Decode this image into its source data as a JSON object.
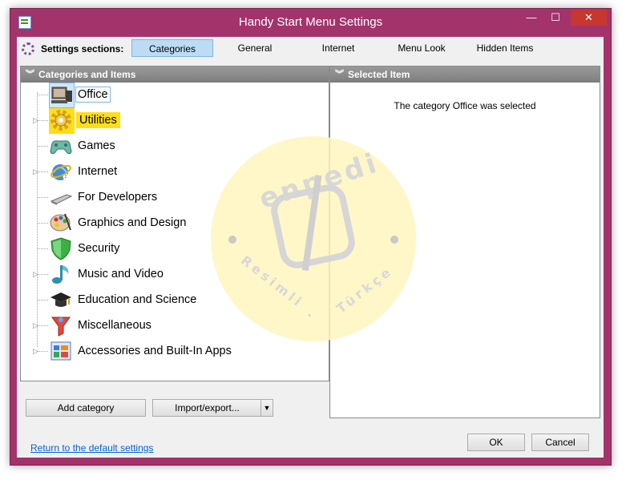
{
  "window": {
    "title": "Handy Start Menu Settings",
    "minimize_glyph": "—",
    "maximize_glyph": "☐",
    "close_glyph": "✕"
  },
  "toolbar": {
    "label": "Settings sections:",
    "tabs": [
      "Categories",
      "General",
      "Internet",
      "Menu Look",
      "Hidden Items"
    ],
    "active_tab": "Categories"
  },
  "left_panel": {
    "header": "Categories and Items",
    "categories": [
      {
        "label": "Office",
        "icon": "office-icon",
        "expandable": false,
        "state": "selected"
      },
      {
        "label": "Utilities",
        "icon": "utilities-gear-icon",
        "expandable": true,
        "state": "highlighted"
      },
      {
        "label": "Games",
        "icon": "gamepad-icon",
        "expandable": false,
        "state": "normal"
      },
      {
        "label": "Internet",
        "icon": "internet-explorer-icon",
        "expandable": true,
        "state": "normal"
      },
      {
        "label": "For Developers",
        "icon": "developer-tools-icon",
        "expandable": false,
        "state": "normal"
      },
      {
        "label": "Graphics and Design",
        "icon": "palette-icon",
        "expandable": false,
        "state": "normal"
      },
      {
        "label": "Security",
        "icon": "shield-icon",
        "expandable": false,
        "state": "normal"
      },
      {
        "label": "Music and Video",
        "icon": "music-note-icon",
        "expandable": true,
        "state": "normal"
      },
      {
        "label": "Education and Science",
        "icon": "graduation-cap-icon",
        "expandable": false,
        "state": "normal"
      },
      {
        "label": "Miscellaneous",
        "icon": "misc-funnel-icon",
        "expandable": true,
        "state": "normal"
      },
      {
        "label": "Accessories and Built-In Apps",
        "icon": "accessories-icon",
        "expandable": true,
        "state": "normal"
      }
    ]
  },
  "right_panel": {
    "header": "Selected Item",
    "message": "The category Office was selected"
  },
  "buttons": {
    "add_category": "Add category",
    "import_export": "Import/export...",
    "ok": "OK",
    "cancel": "Cancel"
  },
  "footer": {
    "reset_link": "Return to the default settings"
  },
  "watermark": {
    "brand": "enpedi",
    "tagline_left": "Resimli",
    "tagline_right": "Türkçe",
    "separator": "."
  },
  "colors": {
    "frame": "#a3336b",
    "close_button": "#c7372f",
    "active_tab": "#bcdcf4",
    "highlight": "#ffde17",
    "link": "#0066cc"
  }
}
